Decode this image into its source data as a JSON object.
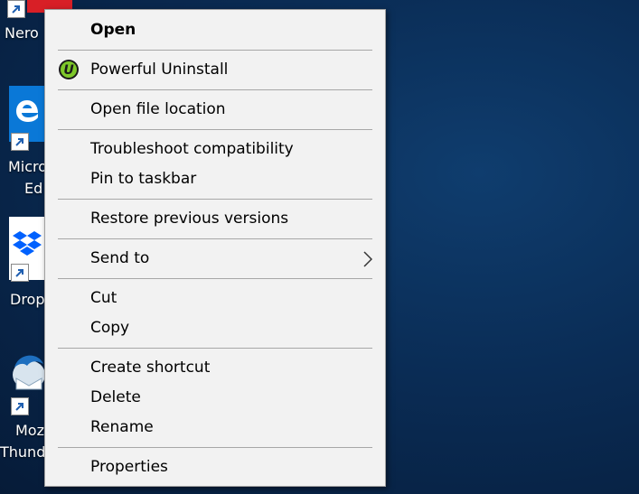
{
  "desktop": {
    "icons": [
      {
        "label": "Nero"
      },
      {
        "label_line1": "Micro",
        "label_line2": "Ed"
      },
      {
        "label": "Drop"
      },
      {
        "label_line1": "Moz",
        "label_line2": "Thund"
      }
    ]
  },
  "context_menu": {
    "items": [
      {
        "label": "Open",
        "bold": true
      },
      {
        "label": "Powerful Uninstall",
        "icon": "powerful-uninstall-icon"
      },
      {
        "label": "Open file location"
      },
      {
        "label": "Troubleshoot compatibility"
      },
      {
        "label": "Pin to taskbar"
      },
      {
        "label": "Restore previous versions"
      },
      {
        "label": "Send to",
        "submenu_icon": "chevron-right-icon"
      },
      {
        "label": "Cut"
      },
      {
        "label": "Copy"
      },
      {
        "label": "Create shortcut"
      },
      {
        "label": "Delete"
      },
      {
        "label": "Rename"
      },
      {
        "label": "Properties"
      }
    ]
  },
  "colors": {
    "menu_background": "#f2f2f2",
    "separator": "#a7a7a7",
    "desktop_background": "#0a2c55",
    "uninstall_icon_green": "#7ec82a"
  }
}
